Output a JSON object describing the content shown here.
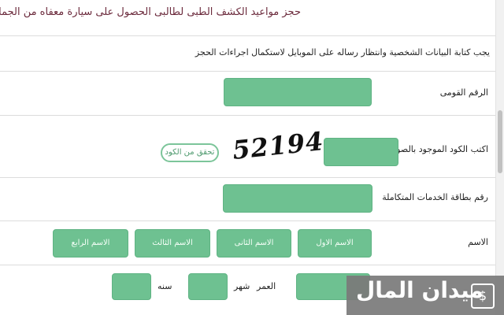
{
  "header": {
    "title": "حجز مواعيد الكشف الطبى لطالبى الحصول على سيارة معفاه من الجمارك"
  },
  "form": {
    "instructions": "يجب كتابة البيانات الشخصية وانتظار رساله على الموبايل لاستكمال اجراءات الحجز",
    "national_id_label": "الرقم القومى",
    "captcha_label": "اكتب الكود الموجود بالصورة",
    "captcha_code": "52194",
    "verify_button": "تحقق من الكود",
    "services_card_label": "رقم بطاقة الخدمات المتكاملة",
    "name_label": "الاسم",
    "name_first": "الاسم الاول",
    "name_second": "الاسم الثانى",
    "name_third": "الاسم الثالث",
    "name_fourth": "الاسم الرابع",
    "age_label": "العمر",
    "month_label": "شهر",
    "year_label": "سنه"
  },
  "watermark": {
    "text": "ميدان المال",
    "icon": "dollar-card-icon"
  },
  "colors": {
    "field_green": "#6ec191",
    "title_maroon": "#6b2a3c"
  }
}
